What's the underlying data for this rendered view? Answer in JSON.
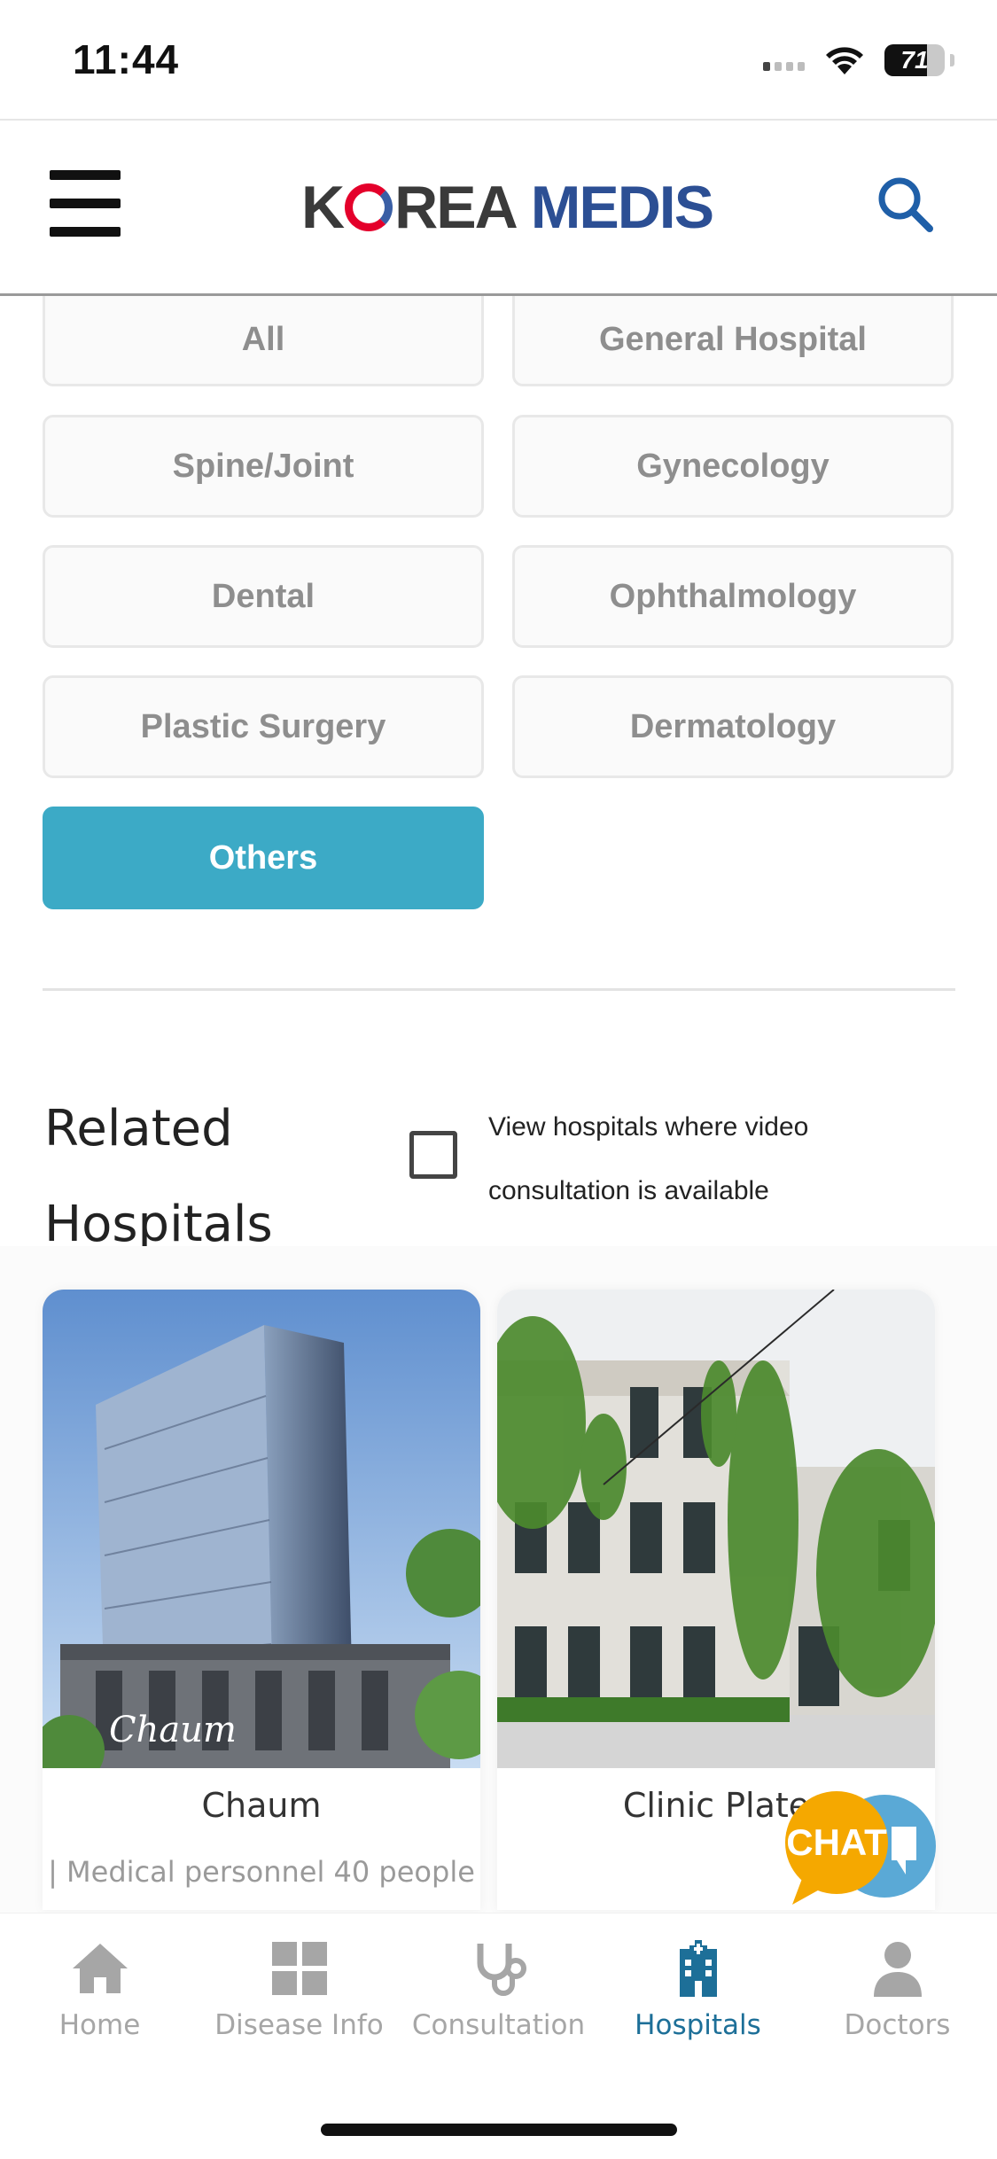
{
  "status_bar": {
    "time": "11:44",
    "battery_percent": "71",
    "battery_level": 0.71
  },
  "header": {
    "logo_part1": "K",
    "logo_part2": "REA",
    "logo_part3": "MEDIS",
    "menu_icon": "hamburger-menu-icon",
    "search_icon": "search-icon"
  },
  "categories": {
    "selected": "Others",
    "items": [
      {
        "label": "All"
      },
      {
        "label": "General Hospital"
      },
      {
        "label": "Spine/Joint"
      },
      {
        "label": "Gynecology"
      },
      {
        "label": "Dental"
      },
      {
        "label": "Ophthalmology"
      },
      {
        "label": "Plastic Surgery"
      },
      {
        "label": "Dermatology"
      },
      {
        "label": "Others"
      }
    ]
  },
  "related": {
    "title": "Related Hospitals",
    "video_filter_label": "View hospitals where video consultation is available",
    "video_filter_checked": false
  },
  "hospitals": [
    {
      "name": "Chaum",
      "meta": "| Medical personnel 40 people"
    },
    {
      "name": "Clinic Plate",
      "meta": ""
    }
  ],
  "chat": {
    "label": "CHAT",
    "icon": "chat-bubble-icon"
  },
  "bottom_nav": {
    "active": "Hospitals",
    "items": [
      {
        "label": "Home",
        "icon": "home-icon"
      },
      {
        "label": "Disease Info",
        "icon": "grid-icon"
      },
      {
        "label": "Consultation",
        "icon": "stethoscope-icon"
      },
      {
        "label": "Hospitals",
        "icon": "hospital-icon"
      },
      {
        "label": "Doctors",
        "icon": "person-icon"
      }
    ]
  },
  "colors": {
    "accent": "#3caac6",
    "nav_active": "#1d6f98",
    "logo_blue": "#2c4f94",
    "logo_red": "#e4002b",
    "chat_yellow": "#f5a800",
    "chat_blue": "#5aa9d6"
  }
}
